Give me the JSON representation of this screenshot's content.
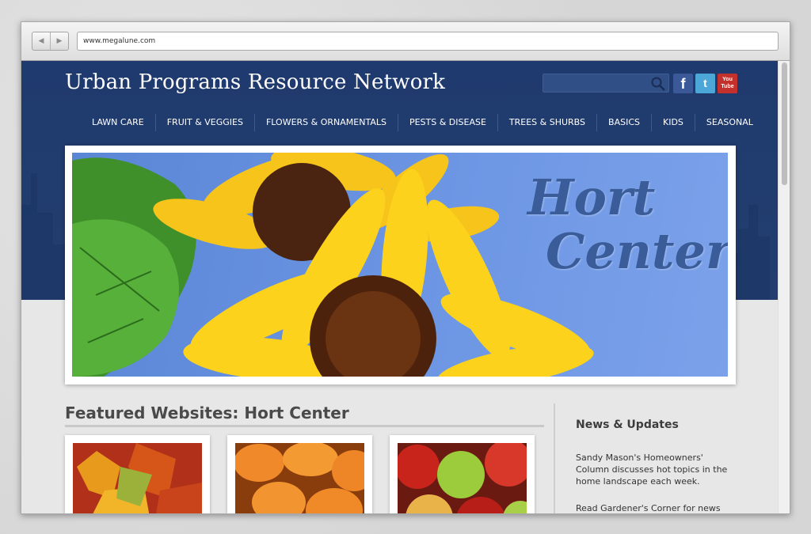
{
  "browser": {
    "url": "www.megalune.com",
    "back_icon": "back-arrow-icon",
    "forward_icon": "forward-arrow-icon"
  },
  "site": {
    "title": "Urban Programs Resource Network",
    "search_icon": "search-icon",
    "social": [
      {
        "name": "facebook-icon",
        "label": "f"
      },
      {
        "name": "twitter-icon",
        "label": "t"
      },
      {
        "name": "youtube-icon",
        "label": "You Tube"
      }
    ]
  },
  "nav": {
    "items": [
      "LAWN CARE",
      "FRUIT & VEGGIES",
      "FLOWERS & ORNAMENTALS",
      "PESTS & DISEASE",
      "TREES & SHURBS",
      "BASICS",
      "KIDS",
      "SEASONAL"
    ]
  },
  "banner": {
    "line1": "Hort",
    "line2": "Center"
  },
  "featured": {
    "title": "Featured Websites: Hort Center"
  },
  "news": {
    "title": "News & Updates",
    "p1": "Sandy Mason's Homeowners' Column discusses hot topics in the home landscape each week.",
    "p2": "Read Gardener's Corner for news"
  },
  "colors": {
    "header": "#1f3a6e",
    "accent_text": "#3a5c98"
  }
}
